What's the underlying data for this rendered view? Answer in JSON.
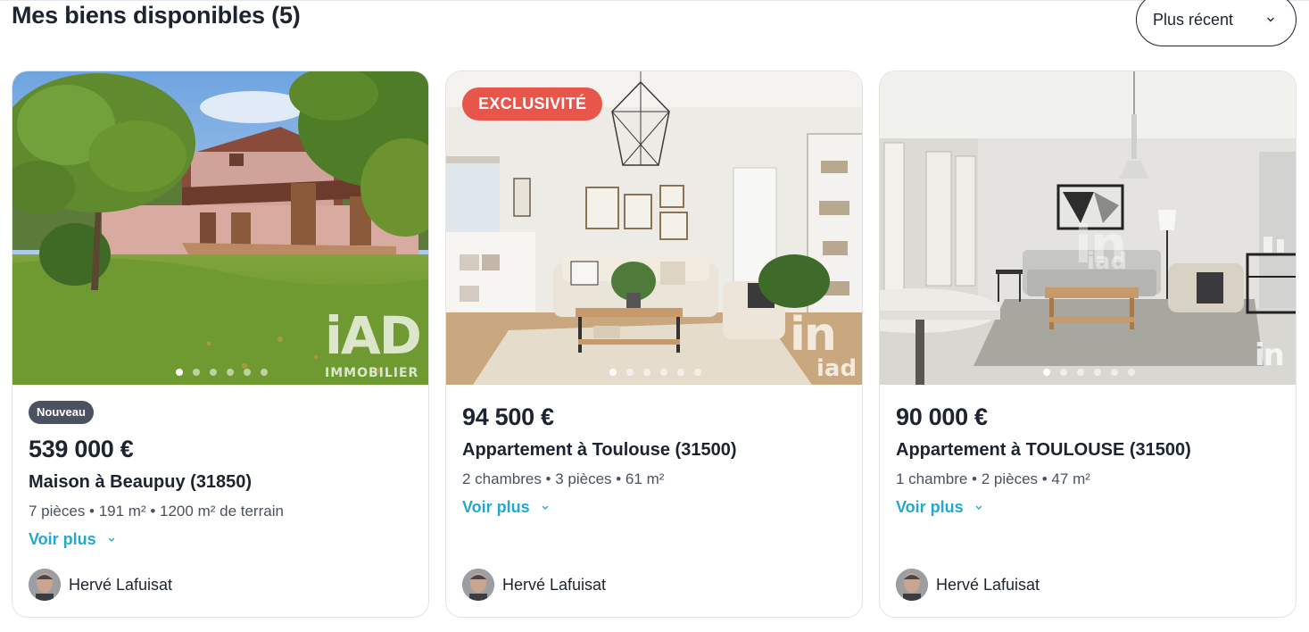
{
  "header": {
    "title": "Mes biens disponibles (5)",
    "sort": {
      "selected": "Plus récent",
      "icon": "chevron-down-icon"
    }
  },
  "colors": {
    "text": "#1c2331",
    "link": "#23a8d0",
    "badge_exclusive": "#e8554a",
    "badge_new": "#4a5261"
  },
  "listings": [
    {
      "badge": "Nouveau",
      "exclusive": "",
      "price": "539 000 €",
      "title": "Maison à Beaupuy (31850)",
      "details": "7 pièces • 191 m² • 1200 m² de terrain",
      "more_label": "Voir plus",
      "agent": "Hervé Lafuisat",
      "photo_count": 6,
      "photo_active": 0
    },
    {
      "badge": "",
      "exclusive": "EXCLUSIVITÉ",
      "price": "94 500 €",
      "title": "Appartement à Toulouse (31500)",
      "details": "2 chambres • 3 pièces • 61 m²",
      "more_label": "Voir plus",
      "agent": "Hervé Lafuisat",
      "photo_count": 6,
      "photo_active": 0
    },
    {
      "badge": "",
      "exclusive": "",
      "price": "90 000 €",
      "title": "Appartement à TOULOUSE (31500)",
      "details": "1 chambre • 2 pièces • 47 m²",
      "more_label": "Voir plus",
      "agent": "Hervé Lafuisat",
      "photo_count": 6,
      "photo_active": 0
    }
  ]
}
